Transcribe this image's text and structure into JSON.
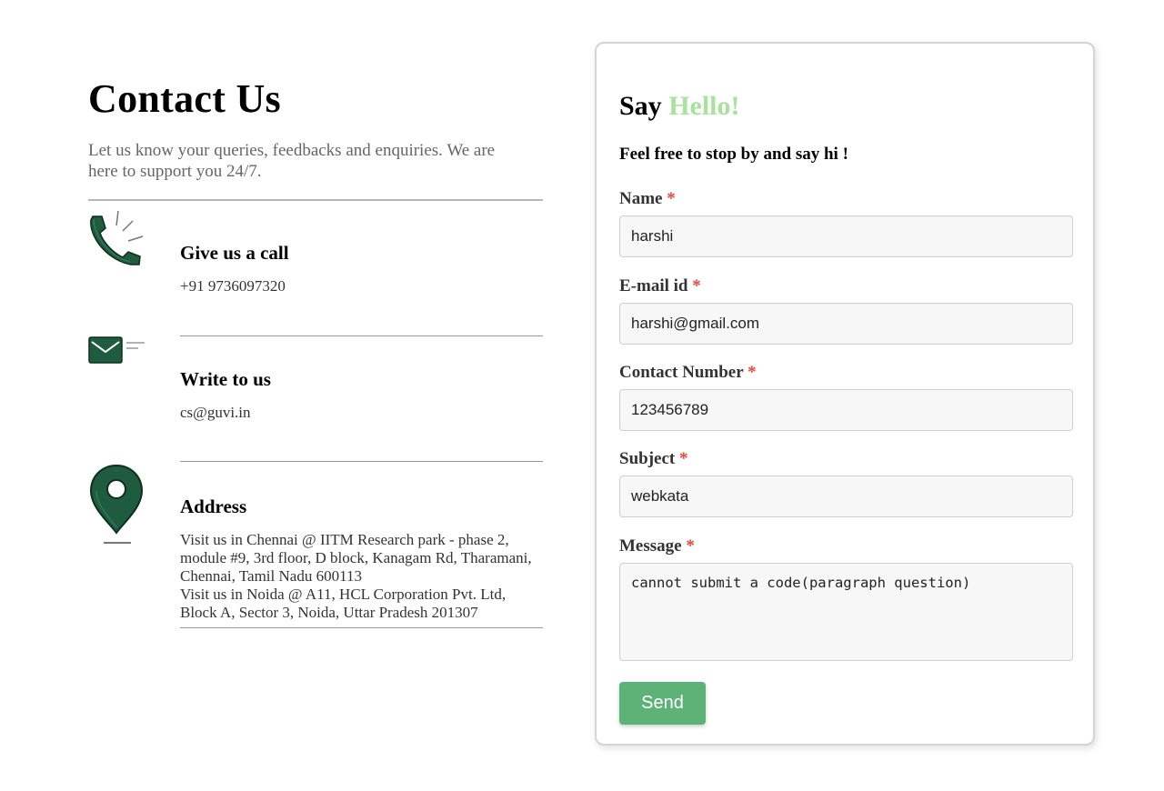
{
  "contact": {
    "title": "Contact Us",
    "intro": "Let us know your queries, feedbacks and enquiries. We are here to support you 24/7.",
    "call": {
      "icon": "phone-icon",
      "heading": "Give us a call",
      "text": "+91 9736097320"
    },
    "write": {
      "icon": "envelope-icon",
      "heading": "Write to us",
      "text": "cs@guvi.in"
    },
    "address": {
      "icon": "location-pin-icon",
      "heading": "Address",
      "line1": "Visit us in Chennai @ IITM Research park - phase 2, module #9, 3rd floor, D block, Kanagam Rd, Tharamani, Chennai, Tamil Nadu 600113",
      "line2": "Visit us in Noida @ A11, HCL Corporation Pvt. Ltd, Block A, Sector 3, Noida, Uttar Pradesh 201307"
    },
    "icon_color": "#1f5c3f"
  },
  "form": {
    "title_prefix": "Say",
    "title_accent": "Hello!",
    "accent_color": "#a8e39d",
    "subtitle": "Feel free to stop by and say hi !",
    "required_mark": "*",
    "fields": {
      "name": {
        "label": "Name",
        "value": "harshi"
      },
      "email": {
        "label": "E-mail id",
        "value": "harshi@gmail.com"
      },
      "contact": {
        "label": "Contact Number",
        "value": "123456789"
      },
      "subject": {
        "label": "Subject",
        "value": "webkata"
      },
      "message": {
        "label": "Message",
        "value": "cannot submit a code(paragraph question)"
      }
    },
    "send_label": "Send",
    "send_color": "#5fb277"
  }
}
